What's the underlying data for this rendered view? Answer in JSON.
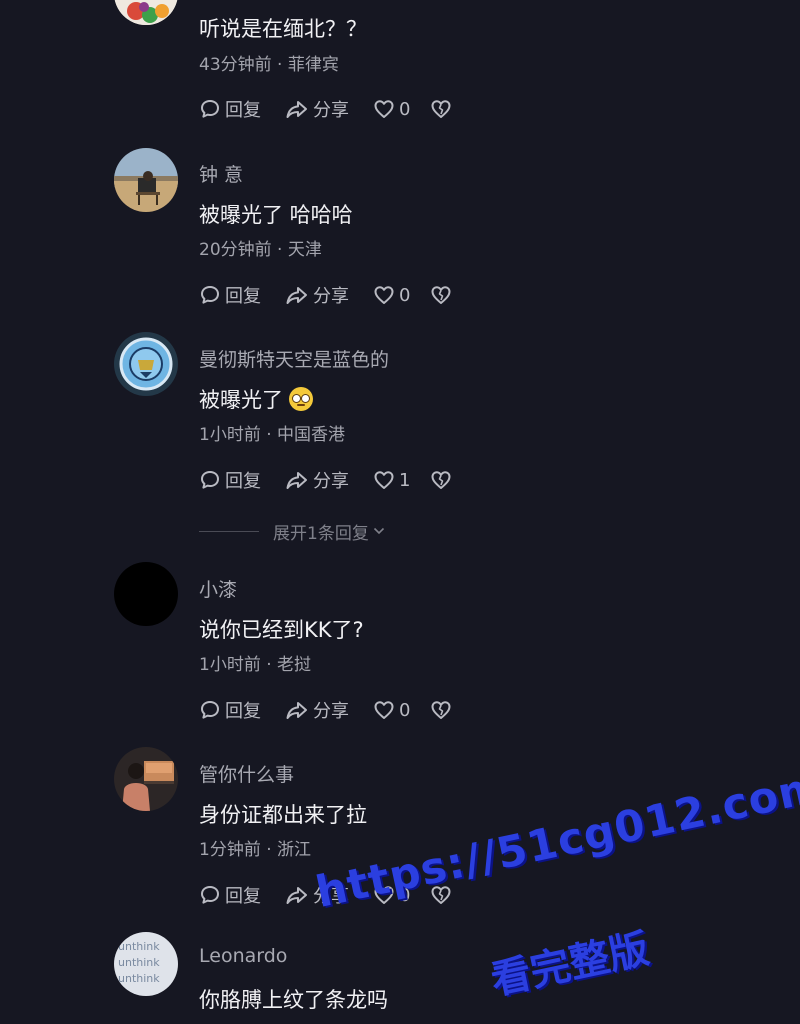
{
  "actions": {
    "reply_label": "回复",
    "share_label": "分享"
  },
  "expand_replies_label": "展开1条回复",
  "comments": [
    {
      "username": "",
      "text": "听说是在缅北？？",
      "time": "43分钟前",
      "location": "菲律宾",
      "likes": "0",
      "avatar": "fruit-avatar"
    },
    {
      "username": "钟 意",
      "text": "被曝光了 哈哈哈",
      "time": "20分钟前",
      "location": "天津",
      "likes": "0",
      "avatar": "desert-chair-avatar"
    },
    {
      "username": "曼彻斯特天空是蓝色的",
      "text": "被曝光了",
      "time": "1小时前",
      "location": "中国香港",
      "likes": "1",
      "avatar": "manchester-city-crest-avatar",
      "emoji": "rolling-eyes-emoji"
    },
    {
      "username": "小漆",
      "text": "说你已经到KK了?",
      "time": "1小时前",
      "location": "老挝",
      "likes": "0",
      "avatar": "black-avatar"
    },
    {
      "username": "管你什么事",
      "text": "身份证都出来了拉",
      "time": "1分钟前",
      "location": "浙江",
      "likes": "0",
      "avatar": "person-sunset-avatar"
    },
    {
      "username": "Leonardo",
      "text": "你胳膊上纹了条龙吗",
      "avatar": "unthink-text-avatar"
    }
  ],
  "watermark": {
    "url": "https://51cg012.com",
    "subtitle": "看完整版"
  },
  "colors": {
    "background": "#161722",
    "primary_text": "#f1f1f4",
    "secondary_text": "#a3a4ad",
    "watermark": "#2b3fe0"
  }
}
